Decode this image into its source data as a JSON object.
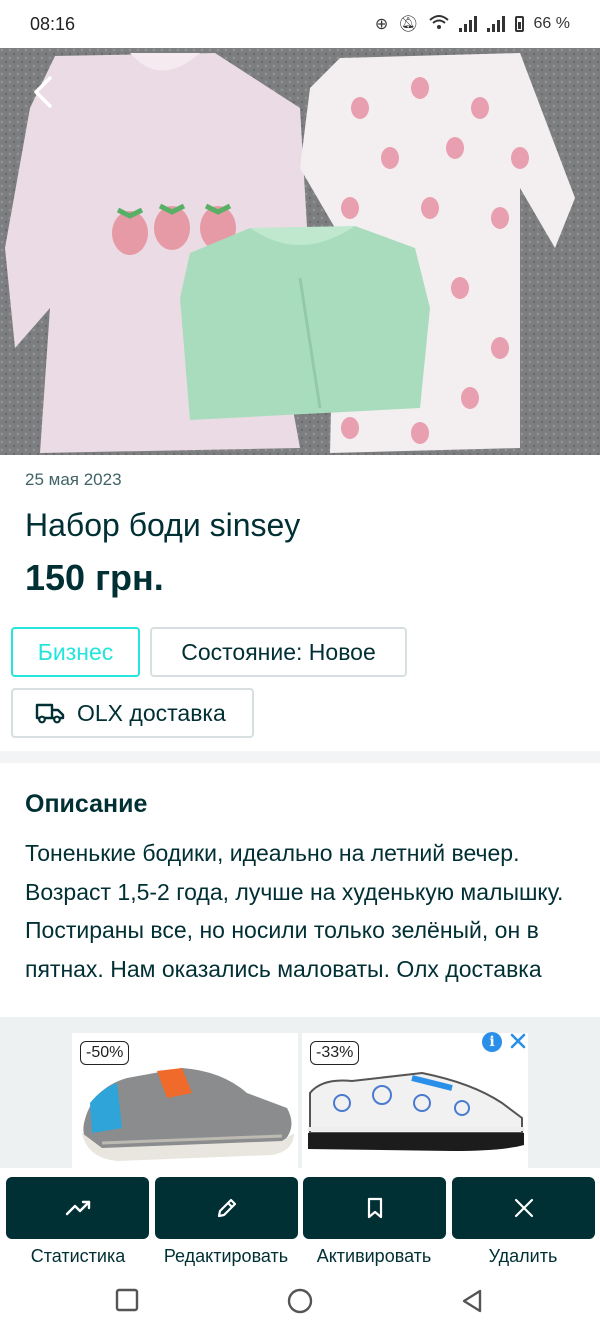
{
  "status_bar": {
    "time": "08:16",
    "battery": "66 %"
  },
  "listing": {
    "date": "25 мая 2023",
    "title": "Набор боди sinsey",
    "price": "150 грн.",
    "tags": {
      "business": "Бизнес",
      "condition": "Состояние: Новое",
      "delivery": "OLX доставка"
    }
  },
  "description": {
    "heading": "Описание",
    "text": "Тоненькие бодики, идеально на летний вечер. Возраст 1,5-2 года, лучше на худенькую малышку. Постираны все, но носили только зелёный, он в пятнах. Нам оказались маловаты. Олх доставка"
  },
  "ads": {
    "left_discount": "-50%",
    "right_discount": "-33%"
  },
  "actions": {
    "stats": "Статистика",
    "edit": "Редактировать",
    "activate": "Активировать",
    "delete": "Удалить"
  },
  "icons": [
    "back-icon",
    "trending-up-icon",
    "pencil-icon",
    "bookmark-icon",
    "close-icon",
    "truck-icon",
    "info-icon"
  ],
  "colors": {
    "brand_dark": "#002f34",
    "accent_teal": "#23e5db",
    "text_muted": "#406367"
  }
}
